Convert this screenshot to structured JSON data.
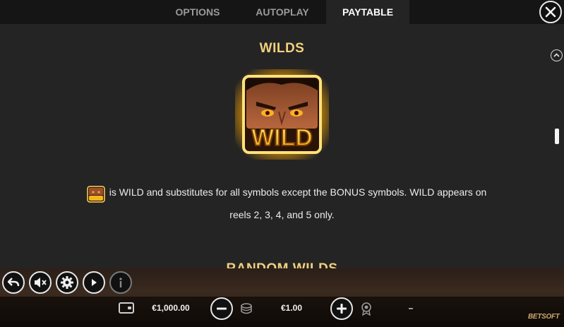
{
  "tabs": [
    {
      "label": "OPTIONS",
      "active": false
    },
    {
      "label": "AUTOPLAY",
      "active": false
    },
    {
      "label": "PAYTABLE",
      "active": true
    }
  ],
  "paytable": {
    "section_title": "WILDS",
    "wild_symbol_text": "WILD",
    "description_line1": "is WILD and substitutes for all symbols except the BONUS symbols. WILD appears on",
    "description_line2": "reels 2, 3, 4, and 5 only.",
    "next_section_title": "RANDOM WILDS"
  },
  "controls": {
    "icons": [
      "back-arrow-icon",
      "sound-muted-icon",
      "gear-icon",
      "autoplay-icon",
      "info-icon"
    ]
  },
  "footer": {
    "balance": "€1,000.00",
    "bet": "€1.00",
    "win": "–",
    "brand": "BETSOFT"
  },
  "colors": {
    "accent_gold": "#f2cf7d",
    "panel_bg": "#242424",
    "tabbar_bg": "#151515"
  }
}
